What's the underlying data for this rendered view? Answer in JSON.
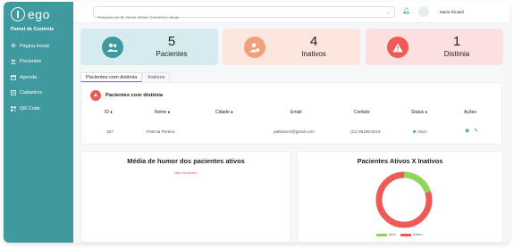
{
  "app": {
    "logo_text": "ego"
  },
  "sidebar": {
    "title": "Painel de Controle",
    "items": [
      {
        "label": "Página Inicial",
        "icon": "gear-icon"
      },
      {
        "label": "Pacientes",
        "icon": "users-icon"
      },
      {
        "label": "Agenda",
        "icon": "calendar-icon"
      },
      {
        "label": "Cadastros",
        "icon": "form-icon"
      },
      {
        "label": "QR Code",
        "icon": "qrcode-icon"
      }
    ]
  },
  "header": {
    "search_placeholder": "Pesquise por ID, Nome, Email, Convênio e Idade",
    "user_name": "Maria Rinaldi"
  },
  "stats": [
    {
      "value": "5",
      "label": "Pacientes",
      "color": "#d6ebed",
      "accent": "#3e9a9e"
    },
    {
      "value": "4",
      "label": "Inativos",
      "color": "#fbe5dc",
      "accent": "#f0a07a"
    },
    {
      "value": "1",
      "label": "Distimia",
      "color": "#fbe0df",
      "accent": "#ec5b55"
    }
  ],
  "tabs": [
    {
      "label": "Pacientes com distimia",
      "active": true
    },
    {
      "label": "Inativos",
      "active": false
    }
  ],
  "table": {
    "title": "Pacientes com distimia",
    "columns": [
      "ID ⬧",
      "Nome ⬧",
      "Cidade ⬧",
      "Email",
      "Contato",
      "Status ⬧",
      "Ações"
    ],
    "rows": [
      {
        "id": "157",
        "nome": "Patricia Pereira",
        "cidade": "",
        "email": "patibarvm@gmail.com",
        "contato": "(11) 95196-5216",
        "status": "Ativo"
      }
    ]
  },
  "mood_panel": {
    "title": "Média de humor dos pacientes ativos",
    "empty_text": "Não há dados."
  },
  "pie_panel": {
    "title": "Pacientes Ativos X Inativos"
  },
  "chart_data": {
    "type": "pie",
    "series": [
      {
        "name": "Ativo",
        "value": 1,
        "color": "#8ed65a"
      },
      {
        "name": "Inativo",
        "value": 4,
        "color": "#ee5a56"
      }
    ],
    "legend": "bottom"
  }
}
